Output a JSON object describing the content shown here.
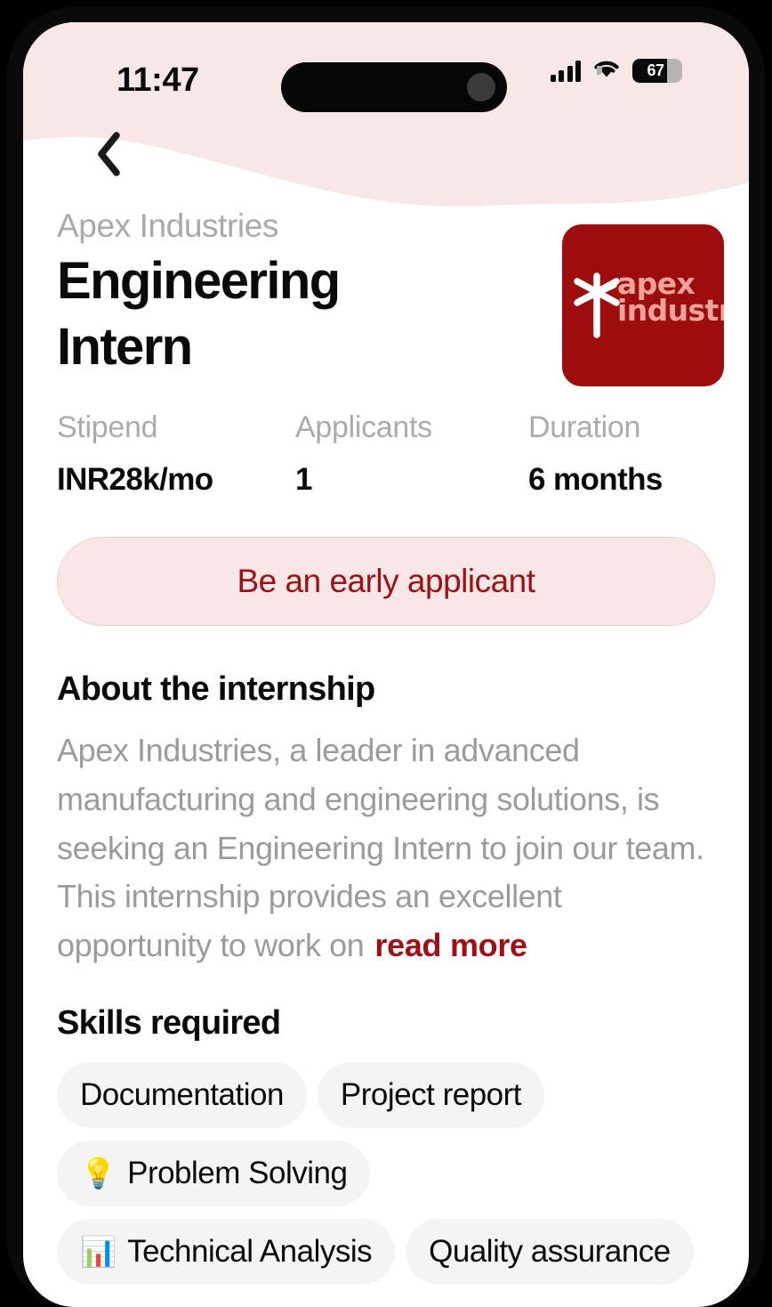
{
  "status_bar": {
    "time": "11:47",
    "battery_level": "67",
    "signal_icon": "cellular-bars-icon",
    "wifi_icon": "wifi-icon",
    "battery_icon": "battery-icon"
  },
  "nav": {
    "back_icon": "chevron-left-icon"
  },
  "job": {
    "company": "Apex Industries",
    "title": "Engineering Intern",
    "logo": {
      "line1": "apex",
      "line2": "industries",
      "star_icon": "asterisk-star-icon",
      "background_color": "#9e0d0d",
      "text_color": "#f0a39c"
    }
  },
  "stats": [
    {
      "label": "Stipend",
      "value": "INR28k/mo"
    },
    {
      "label": "Applicants",
      "value": "1"
    },
    {
      "label": "Duration",
      "value": "6 months"
    }
  ],
  "cta": {
    "label": "Be an early applicant",
    "text_color": "#9e1017",
    "background_color": "#f9e6e6"
  },
  "about": {
    "heading": "About the internship",
    "body": "Apex Industries, a leader in advanced manufacturing and engineering solutions, is seeking an Engineering Intern to join our team. This internship provides an excellent opportunity to work on",
    "read_more_label": "read more"
  },
  "skills": {
    "heading": "Skills required",
    "chips": [
      {
        "label": "Documentation",
        "emoji": ""
      },
      {
        "label": "Project report",
        "emoji": ""
      },
      {
        "label": "Problem Solving",
        "emoji": "💡"
      },
      {
        "label": "Technical Analysis",
        "emoji": "📊"
      },
      {
        "label": "Quality assurance",
        "emoji": ""
      }
    ]
  },
  "theme": {
    "header_pink": "#f7e7e6",
    "accent_red": "#a00f15",
    "chip_gray": "#f4f4f4"
  }
}
